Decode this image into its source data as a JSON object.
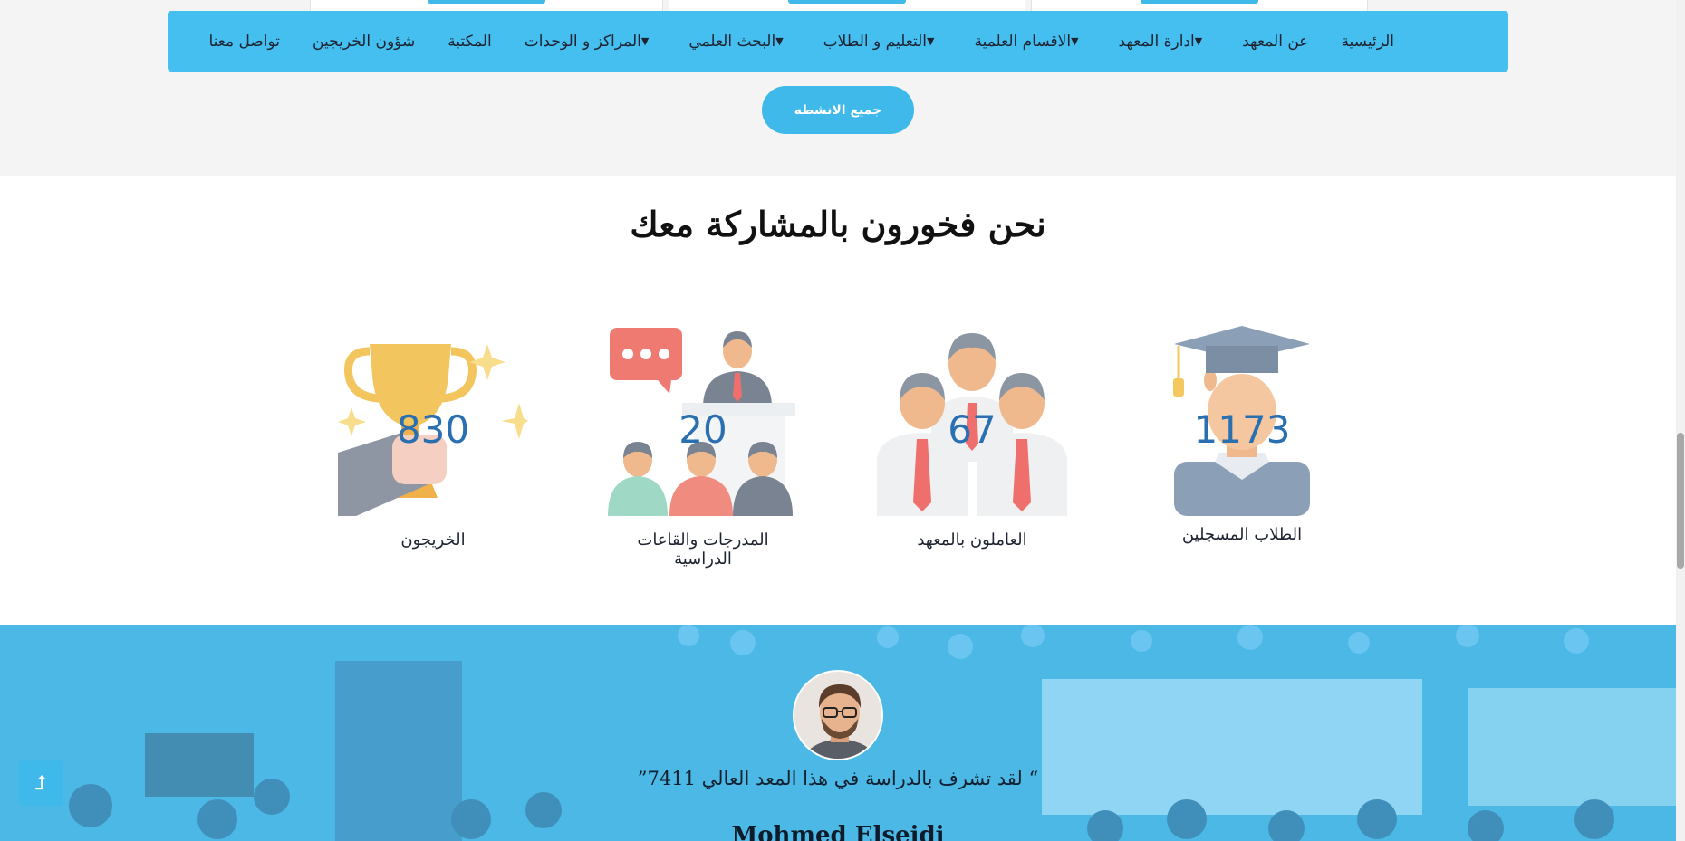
{
  "nav": {
    "items": [
      {
        "label": "الرئيسية",
        "dropdown": false
      },
      {
        "label": "عن المعهد",
        "dropdown": false
      },
      {
        "label": "ادارة المعهد",
        "dropdown": true
      },
      {
        "label": "الاقسام العلمية",
        "dropdown": true
      },
      {
        "label": "التعليم و الطلاب",
        "dropdown": true
      },
      {
        "label": "البحث العلمي",
        "dropdown": true
      },
      {
        "label": "المراكز و الوحدات",
        "dropdown": true
      },
      {
        "label": "المكتبة",
        "dropdown": false
      },
      {
        "label": "شؤون الخريجين",
        "dropdown": false
      },
      {
        "label": "تواصل معنا",
        "dropdown": false
      }
    ]
  },
  "activities_button": "جميع الانشطه",
  "stats": {
    "title": "نحن فخورون بالمشاركة معك",
    "items": [
      {
        "number": "1173",
        "label": "الطلاب المسجلين",
        "icon": "graduate-icon"
      },
      {
        "number": "67",
        "label": "العاملون بالمعهد",
        "icon": "staff-icon"
      },
      {
        "number": "20",
        "label": "المدرجات والقاعات الدراسية",
        "icon": "lecture-hall-icon"
      },
      {
        "number": "830",
        "label": "الخريجون",
        "icon": "trophy-icon"
      }
    ]
  },
  "testimonial": {
    "quote": "“ لقد تشرف بالدراسة في هذا المعد العالي 7411”",
    "name": "Mohmed Elseidi"
  },
  "colors": {
    "accent": "#45bef0",
    "number": "#2a6fb0"
  }
}
